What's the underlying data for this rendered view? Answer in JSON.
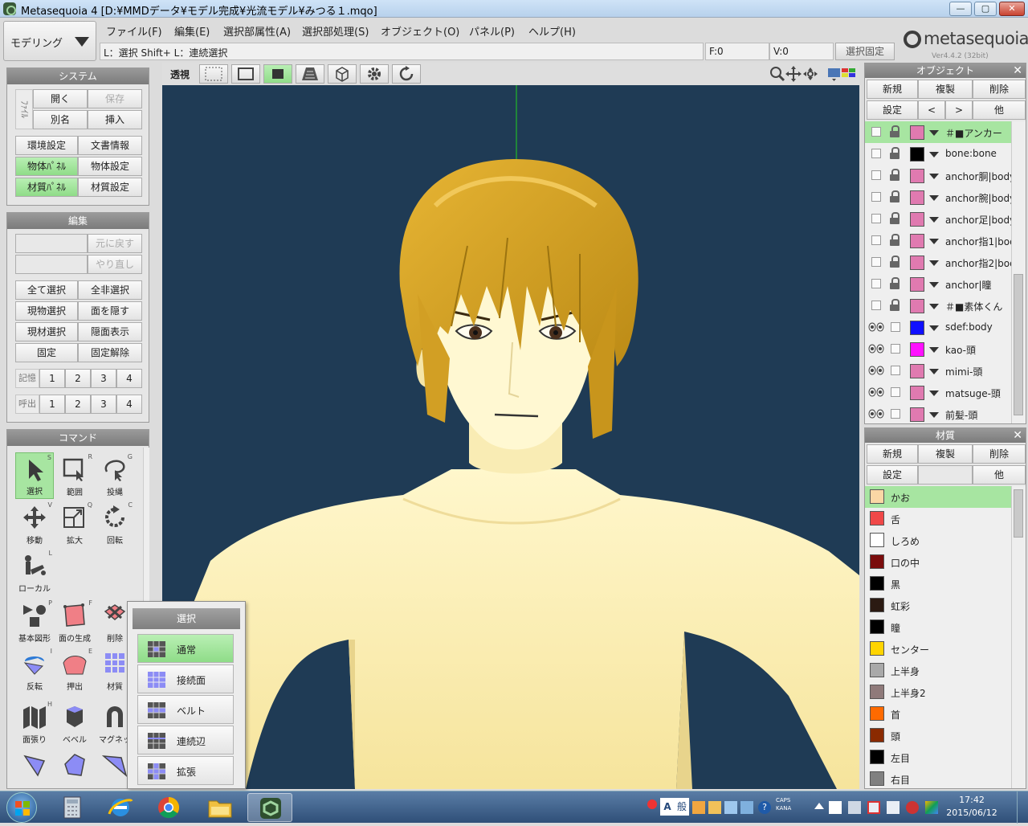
{
  "window": {
    "title": "Metasequoia 4 [D:¥MMDデータ¥モデル完成¥光流モデル¥みつる１.mqo]",
    "min_label": "—",
    "max_label": "▢",
    "close_label": "✕"
  },
  "mode": {
    "label": "モデリング"
  },
  "menu": [
    "ファイル(F)",
    "編集(E)",
    "選択部属性(A)",
    "選択部処理(S)",
    "オブジェクト(O)",
    "パネル(P)",
    "ヘルプ(H)"
  ],
  "hint": "L：選択  Shift+ L：連続選択",
  "status": {
    "f": "F:0",
    "v": "V:0",
    "lock": "選択固定"
  },
  "logo": {
    "word": "metasequoia",
    "num": "4",
    "version": "Ver4.4.2 (32bit)"
  },
  "system_panel": {
    "title": "システム",
    "side": "ﾌｧｲﾙ",
    "open": "開く",
    "save": "保存",
    "saveas": "別名",
    "insert": "挿入",
    "env": "環境設定",
    "docinfo": "文書情報",
    "objpanel": "物体ﾊﾟﾈﾙ",
    "objsettings": "物体設定",
    "matpanel": "材質ﾊﾟﾈﾙ",
    "matsettings": "材質設定"
  },
  "edit_panel": {
    "title": "編集",
    "undo": "元に戻す",
    "redo": "やり直し",
    "selall": "全て選択",
    "deselall": "全非選択",
    "selcurobj": "現物選択",
    "hideface": "面を隠す",
    "selcurmat": "現材選択",
    "showhidden": "隠面表示",
    "fix": "固定",
    "unfix": "固定解除",
    "mem_label": "記憶",
    "call_label": "呼出",
    "slots": [
      "1",
      "2",
      "3",
      "4"
    ]
  },
  "command_panel": {
    "title": "コマンド",
    "tools": [
      {
        "name": "選択",
        "key": "S",
        "icon": "arrow-select-icon"
      },
      {
        "name": "範囲",
        "key": "R",
        "icon": "rect-select-icon"
      },
      {
        "name": "投縄",
        "key": "G",
        "icon": "lasso-icon"
      },
      {
        "name": "移動",
        "key": "V",
        "icon": "move-icon"
      },
      {
        "name": "拡大",
        "key": "Q",
        "icon": "scale-icon"
      },
      {
        "name": "回転",
        "key": "C",
        "icon": "rotate-icon"
      },
      {
        "name": "ローカル",
        "key": "L",
        "icon": "local-icon"
      },
      {
        "name": "基本図形",
        "key": "P",
        "icon": "primitive-icon"
      },
      {
        "name": "面の生成",
        "key": "F",
        "icon": "face-create-icon"
      },
      {
        "name": "削除",
        "key": "",
        "icon": "delete-icon"
      },
      {
        "name": "反転",
        "key": "I",
        "icon": "flip-icon"
      },
      {
        "name": "押出",
        "key": "E",
        "icon": "extrude-icon"
      },
      {
        "name": "材質",
        "key": "",
        "icon": "material-icon"
      },
      {
        "name": "面張り",
        "key": "H",
        "icon": "face-fill-icon"
      },
      {
        "name": "ベベル",
        "key": "",
        "icon": "bevel-icon"
      },
      {
        "name": "マグネッ",
        "key": "",
        "icon": "magnet-icon"
      }
    ]
  },
  "toolbar3d": {
    "persp": "透視"
  },
  "popup": {
    "title": "選択",
    "items": [
      "通常",
      "接続面",
      "ベルト",
      "連続辺",
      "拡張"
    ]
  },
  "object_panel": {
    "title": "オブジェクト",
    "new": "新規",
    "dup": "複製",
    "del": "削除",
    "settings": "設定",
    "prev": "<",
    "next": ">",
    "other": "他",
    "rows": [
      {
        "name": "＃■アンカー",
        "visible": false,
        "locked": true,
        "color": "#e07ab0"
      },
      {
        "name": "bone:bone",
        "visible": false,
        "locked": true,
        "color": "#000000"
      },
      {
        "name": "anchor胴|body",
        "visible": false,
        "locked": true,
        "color": "#e07ab0"
      },
      {
        "name": "anchor腕|body",
        "visible": false,
        "locked": true,
        "color": "#e07ab0"
      },
      {
        "name": "anchor足|body",
        "visible": false,
        "locked": true,
        "color": "#e07ab0"
      },
      {
        "name": "anchor指1|body",
        "visible": false,
        "locked": true,
        "color": "#e07ab0"
      },
      {
        "name": "anchor指2|body",
        "visible": false,
        "locked": true,
        "color": "#e07ab0"
      },
      {
        "name": "anchor|瞳",
        "visible": false,
        "locked": true,
        "color": "#e07ab0"
      },
      {
        "name": "＃■素体くん",
        "visible": false,
        "locked": true,
        "color": "#e07ab0"
      },
      {
        "name": "sdef:body",
        "visible": true,
        "locked": false,
        "color": "#1010ff"
      },
      {
        "name": "kao-頭",
        "visible": true,
        "locked": false,
        "color": "#ff10ff"
      },
      {
        "name": "mimi-頭",
        "visible": true,
        "locked": false,
        "color": "#e07ab0"
      },
      {
        "name": "matsuge-頭",
        "visible": true,
        "locked": false,
        "color": "#e07ab0"
      },
      {
        "name": "前髪-頭",
        "visible": true,
        "locked": false,
        "color": "#e07ab0"
      }
    ]
  },
  "material_panel": {
    "title": "材質",
    "new": "新規",
    "dup": "複製",
    "del": "削除",
    "settings": "設定",
    "other": "他",
    "rows": [
      {
        "name": "かお",
        "color": "#fbd7a5"
      },
      {
        "name": "舌",
        "color": "#f04848"
      },
      {
        "name": "しろめ",
        "color": "#ffffff"
      },
      {
        "name": "口の中",
        "color": "#7a0c0c"
      },
      {
        "name": "黒",
        "color": "#000000"
      },
      {
        "name": "虹彩",
        "color": "#2b1a12"
      },
      {
        "name": "瞳",
        "color": "#000000"
      },
      {
        "name": "センター",
        "color": "#ffd400"
      },
      {
        "name": "上半身",
        "color": "#a9a9a9"
      },
      {
        "name": "上半身2",
        "color": "#8f7a7a"
      },
      {
        "name": "首",
        "color": "#ff6a00"
      },
      {
        "name": "頭",
        "color": "#8a2a00"
      },
      {
        "name": "左目",
        "color": "#000000"
      },
      {
        "name": "右目",
        "color": "#808080"
      }
    ]
  },
  "taskbar": {
    "time": "17:42",
    "date": "2015/06/12",
    "ime_a": "A",
    "ime_mode": "般",
    "caps": "CAPS",
    "kana": "KANA"
  }
}
